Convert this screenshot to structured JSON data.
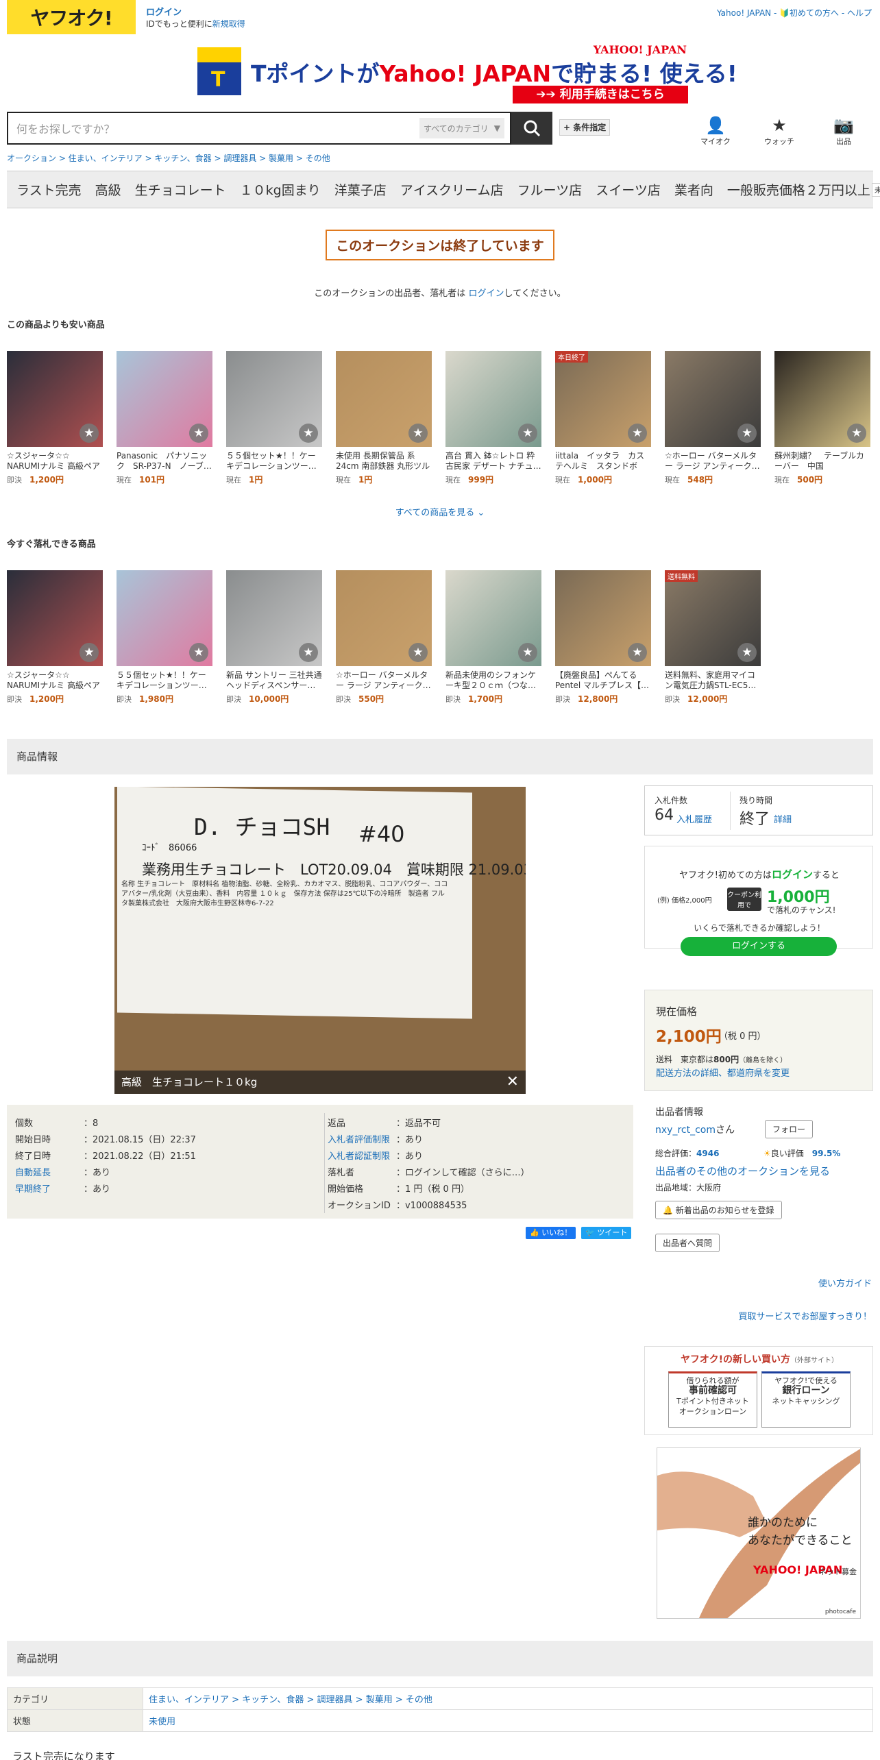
{
  "header": {
    "logo": "ヤフオク!",
    "login": "ログイン",
    "login_sub_prefix": "IDでもっと便利に",
    "register": "新規取得",
    "links": "Yahoo! JAPAN - 🔰初めての方へ - ヘルプ"
  },
  "banner": {
    "cube": "T",
    "text_a": "Tポイントが",
    "text_b": "Yahoo! JAPAN",
    "text_c": "で貯まる! 使える!",
    "brand": "YAHOO! JAPAN",
    "bar": "➔➔ 利用手続きはこちら"
  },
  "search": {
    "placeholder": "何をお探しですか？",
    "category": "すべてのカテゴリ",
    "condition": "+ 条件指定"
  },
  "nav_icons": {
    "mypage": "マイオク",
    "watch": "ウォッチ",
    "sell": "出品"
  },
  "breadcrumb": "オークション > 住まい、インテリア > キッチン、食器 > 調理器具 > 製菓用 > その他",
  "tags": [
    "ラスト完売",
    "高級",
    "生チョコレート",
    "１０kg固まり",
    "洋菓子店",
    "アイスクリーム店",
    "フルーツ店",
    "スイーツ店",
    "業者向",
    "一般販売価格２万円以上"
  ],
  "tag_badge": "未使用",
  "ended": "このオークションは終了しています",
  "ended_note_a": "このオークションの出品者、落札者は ",
  "ended_note_link": "ログイン",
  "ended_note_b": "してください。",
  "cheaper": {
    "title": "この商品よりも安い商品",
    "items": [
      {
        "name": "☆スジャータ☆☆ NARUMIナルミ 高級ペアスー…",
        "label": "即決",
        "price": "1,200円"
      },
      {
        "name": "Panasonic　パナソニック　SR-P37-N　ノーブ…",
        "label": "現在",
        "price": "101円"
      },
      {
        "name": "５５個セット★！！ケーキデコレーションツー…",
        "label": "現在",
        "price": "1円"
      },
      {
        "name": "未使用 長期保管品 系24cm 南部鉄器 丸形ツル付…",
        "label": "現在",
        "price": "1円"
      },
      {
        "name": "高台 貫入 鉢☆レトロ 粋古民家 デザート ナチュ…",
        "label": "現在",
        "price": "999円"
      },
      {
        "name": "iittala　イッタラ　カステヘルミ　スタンドボー…",
        "label": "現在",
        "price": "1,000円",
        "ribbon": "本日終了"
      },
      {
        "name": "☆ホーロー バターメルター ラージ アンティーク…",
        "label": "現在",
        "price": "548円"
      },
      {
        "name": "蘇州刺繍？　テーブルカーバー　中国",
        "label": "現在",
        "price": "500円"
      }
    ]
  },
  "see_all": "すべての商品を見る ⌄",
  "instant": {
    "title": "今すぐ落札できる商品",
    "items": [
      {
        "name": "☆スジャータ☆☆ NARUMIナルミ 高級ペアスー…",
        "label": "即決",
        "price": "1,200円"
      },
      {
        "name": "５５個セット★！！ケーキデコレーションツー…",
        "label": "即決",
        "price": "1,980円"
      },
      {
        "name": "新品 サントリー 三社共通ヘッドディスペンサー…",
        "label": "即決",
        "price": "10,000円"
      },
      {
        "name": "☆ホーロー バターメルター ラージ アンティーク…",
        "label": "即決",
        "price": "550円"
      },
      {
        "name": "新品未使用のシフォンケーキ型２０ｃｍ（つな…",
        "label": "即決",
        "price": "1,700円"
      },
      {
        "name": "【廃盤良品】ぺんてる Pentel マルチプレス【…",
        "label": "即決",
        "price": "12,800円"
      },
      {
        "name": "送料無料、家庭用マイコン電気圧力鍋STL-EC5…",
        "label": "即決",
        "price": "12,000円",
        "ribbon": "送料無料"
      }
    ]
  },
  "product_info_title": "商品情報",
  "image": {
    "line1": "D. チョコSH",
    "line2": "#40",
    "line3": "業務用生チョコレート　LOT20.09.04　賞味期限 21.09.03",
    "line4": "ｺｰﾄﾞ　86066",
    "small": "名称 生チョコレート　原材料名 植物油脂、砂糖、全粉乳、カカオマス、脱脂粉乳、ココアパウダー、ココアバター/乳化剤（大豆由来）、香料　内容量 １０ｋｇ　保存方法 保存は25℃以下の冷暗所　製造者 フルタ製菓株式会社　大阪府大阪市生野区林寺6-7-22",
    "caption": "高級　生チョコレート１０kg",
    "close": "✕"
  },
  "details_left": [
    {
      "k": "個数",
      "v": "：8"
    },
    {
      "k": "開始日時",
      "v": "：2021.08.15（日）22:37"
    },
    {
      "k": "終了日時",
      "v": "：2021.08.22（日）21:51"
    },
    {
      "k": "自動延長",
      "v": "：あり",
      "link": true
    },
    {
      "k": "早期終了",
      "v": "：あり",
      "link": true
    }
  ],
  "details_right": [
    {
      "k": "返品",
      "v": "：返品不可"
    },
    {
      "k": "入札者評価制限",
      "v": "：あり",
      "link": true
    },
    {
      "k": "入札者認証制限",
      "v": "：あり",
      "link": true
    },
    {
      "k": "落札者",
      "v": "：ログインして確認（さらに…）"
    },
    {
      "k": "開始価格",
      "v": "：1 円（税 0 円）"
    },
    {
      "k": "オークションID",
      "v": "：v1000884535"
    }
  ],
  "social": {
    "like": "👍 いいね！",
    "tweet": "🐦 ツイート"
  },
  "bid": {
    "count_label": "入札件数",
    "count": "64",
    "history": "入札履歴",
    "time_label": "残り時間",
    "time": "終了",
    "detail": "詳細"
  },
  "promo": {
    "line1a": "ヤフオク!初めての方は",
    "line1b": "ログイン",
    "line1c": "すると",
    "example": "(例) 価格2,000円",
    "coupon": "クーポン利用で",
    "amount": "1,000円",
    "line2": "で落札のチャンス!",
    "line3": "いくらで落札できるか確認しよう！",
    "button": "ログインする"
  },
  "price": {
    "label": "現在価格",
    "value": "2,100円",
    "tax": "（税 0 円）",
    "ship_label": "送料",
    "ship_dest": "東京都は",
    "ship_amount": "800円",
    "ship_note": "（離島を除く）",
    "ship_link": "配送方法の詳細、都道府県を変更"
  },
  "seller": {
    "title": "出品者情報",
    "name": "nxy_rct_com",
    "san": "さん",
    "follow": "フォロー",
    "rating_label": "総合評価：",
    "rating": "4946",
    "good_label": "良い評価",
    "good": "99.5%",
    "others": "出品者のその他のオークションを見る",
    "region": "出品地域：大阪府",
    "notify": "🔔 新着出品のお知らせを登録",
    "contact": "出品者へ質問"
  },
  "guide": "使い方ガイド",
  "buyservice": "買取サービスでお部屋すっきり！",
  "newbuy": {
    "title": "ヤフオク!の新しい買い方",
    "ext": "（外部サイト）",
    "c1a": "借りられる額が",
    "c1b": "事前確認可",
    "c1c": "Tポイント付きネット",
    "c1d": "オークションローン",
    "c2a": "ヤフオク!で使える",
    "c2b": "銀行ローン",
    "c2c": "ネットキャッシング"
  },
  "ad": {
    "line1": "誰かのために",
    "line2": "あなたができること",
    "brand": "YAHOO! JAPAN",
    "sub": "ネット募金",
    "credit": "photocafe"
  },
  "desc_title": "商品説明",
  "table": {
    "cat_label": "カテゴリ",
    "cat_value": "住まい、インテリア > キッチン、食器 > 調理器具 > 製菓用 > その他",
    "state_label": "状態",
    "state_value": "未使用"
  },
  "footer_text": "ラスト完売になります",
  "colors": {
    "yellow": "#ffdd2b",
    "link": "#1a6eb8",
    "price": "#c0580f",
    "green": "#17b13a"
  }
}
